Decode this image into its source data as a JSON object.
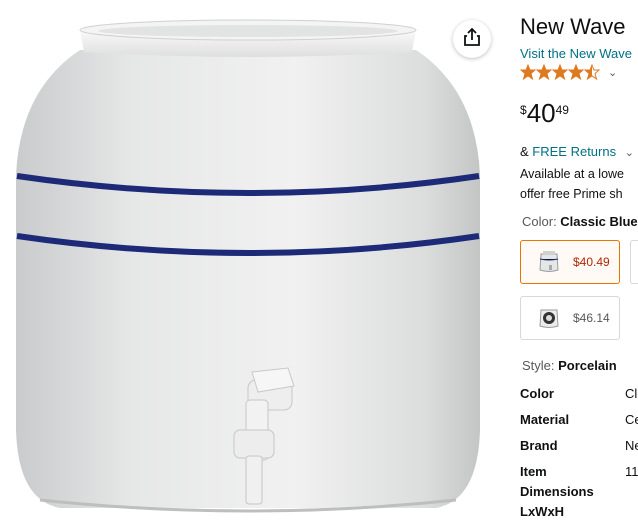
{
  "product": {
    "title": "New Wave",
    "store_link": "Visit the New Wave",
    "rating_stars": 4.5,
    "price": {
      "symbol": "$",
      "whole": "40",
      "fraction": "49"
    },
    "returns_prefix": "& ",
    "returns_link": "FREE Returns",
    "availability_line1": "Available at a lowe",
    "availability_line2": "offer free Prime sh",
    "color_label": "Color: ",
    "color_value": "Classic Blue",
    "swatches": [
      {
        "price": "$40.49",
        "selected": true
      },
      {
        "price": "$46.14",
        "selected": false
      }
    ],
    "style_label": "Style: ",
    "style_value": "Porcelain",
    "specs": [
      {
        "key": "Color",
        "value": "Cl"
      },
      {
        "key": "Material",
        "value": "Ce"
      },
      {
        "key": "Brand",
        "value": "Ne"
      },
      {
        "key": "Item Dimensions LxWxH",
        "value": "11"
      }
    ]
  },
  "colors": {
    "link": "#007185",
    "star": "#de7921",
    "selected_border": "#e77600",
    "price_red": "#b12704",
    "stripe": "#1c2a78"
  },
  "icons": {
    "share": "share-icon",
    "star": "star-icon",
    "chevron": "chevron-down-icon"
  }
}
